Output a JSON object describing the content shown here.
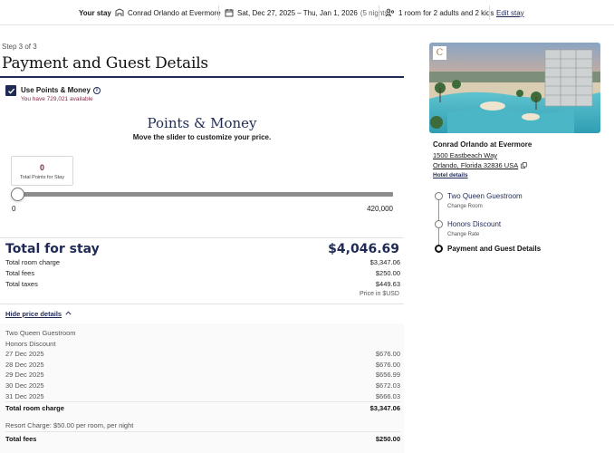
{
  "topbar": {
    "your_stay": "Your stay",
    "hotel": "Conrad Orlando at Evermore",
    "dates": "Sat, Dec 27, 2025 – Thu, Jan 1, 2026",
    "nights": "(5 nights)",
    "guests": "1 room for 2 adults and 2 kids",
    "edit": "Edit stay"
  },
  "page": {
    "step": "Step 3 of 3",
    "title": "Payment and Guest Details"
  },
  "points": {
    "checkbox_label": "Use Points & Money",
    "checked": true,
    "available": "You have 729,021 available",
    "section_title": "Points & Money",
    "instruction": "Move the slider to customize your price.",
    "total_points_value": "0",
    "total_points_label": "Total Points for Stay",
    "slider_min": "0",
    "slider_max": "420,000",
    "slider_fraction": 0
  },
  "totals": {
    "label": "Total for stay",
    "value": "$4,046.69",
    "room_charge_label": "Total room charge",
    "room_charge_value": "$3,347.06",
    "fees_label": "Total fees",
    "fees_value": "$250.00",
    "taxes_label": "Total taxes",
    "taxes_value": "$449.63",
    "currency_note": "Price in $USD"
  },
  "details": {
    "toggle": "Hide price details",
    "room_type": "Two Queen Guestroom",
    "rate": "Honors Discount",
    "nights": [
      {
        "date": "27 Dec 2025",
        "price": "$676.00"
      },
      {
        "date": "28 Dec 2025",
        "price": "$676.00"
      },
      {
        "date": "29 Dec 2025",
        "price": "$656.99"
      },
      {
        "date": "30 Dec 2025",
        "price": "$672.03"
      },
      {
        "date": "31 Dec 2025",
        "price": "$666.03"
      }
    ],
    "room_total_label": "Total room charge",
    "room_total_value": "$3,347.06",
    "resort_charge": "Resort Charge: $50.00 per room, per night",
    "fees_total_label": "Total fees",
    "fees_total_value": "$250.00"
  },
  "hotel": {
    "logo_letter": "C",
    "name": "Conrad Orlando at Evermore",
    "address1": "1500 Eastbeach Way",
    "address2": "Orlando, Florida 32836 USA",
    "details_link": "Hotel details"
  },
  "timeline": {
    "step1": "Two Queen Guestroom",
    "step1_sub": "Change Room",
    "step2": "Honors Discount",
    "step2_sub": "Change Rate",
    "step3": "Payment and Guest Details"
  },
  "colors": {
    "navy": "#1f2a55",
    "maroon": "#8a2846"
  }
}
